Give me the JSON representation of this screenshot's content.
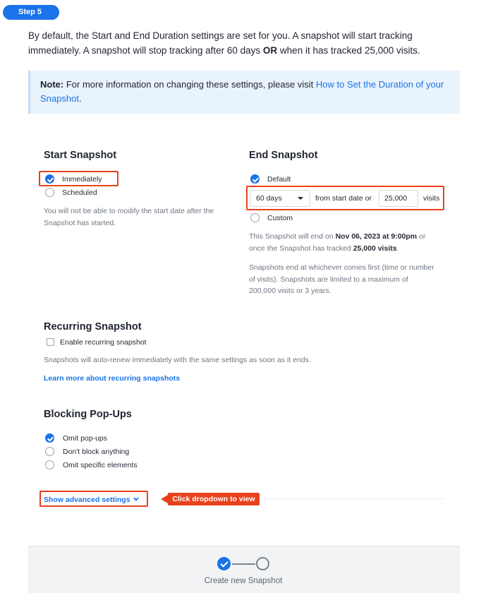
{
  "step_badge": "Step 5",
  "intro": {
    "part1": "By default, the Start and End Duration settings are set for you. A snapshot will start tracking immediately. A snapshot will stop tracking after 60 days ",
    "bold": "OR",
    "part2": " when it has tracked 25,000 visits."
  },
  "note": {
    "label": "Note:",
    "text": " For more information on changing these settings, please visit ",
    "link": "How to Set the Duration of your Snapshot",
    "end": "."
  },
  "start_snapshot": {
    "title": "Start Snapshot",
    "options": [
      {
        "label": "Immediately",
        "selected": true
      },
      {
        "label": "Scheduled",
        "selected": false
      }
    ],
    "help_line1": "You will not be able to modify the start date after the",
    "help_line2": "Snapshot has started."
  },
  "end_snapshot": {
    "title": "End Snapshot",
    "default_label": "Default",
    "duration_select": "60 days",
    "from_text": "from start date or",
    "visits_value": "25,000",
    "visits_label": "visits",
    "custom_label": "Custom",
    "summary": {
      "line1_pre": "This Snapshot will end on ",
      "line1_date": "Nov 06, 2023 at 9:00pm",
      "line1_post": " or",
      "line2_pre": "once the Snapshot has tracked ",
      "line2_visits": "25,000 visits",
      "line2_post": "."
    },
    "limits_line1": "Snapshots end at whichever comes first (time or number",
    "limits_line2": "of visits). Snapshots are limited to a maximum of",
    "limits_line3": "200,000 visits or 3 years."
  },
  "recurring": {
    "title": "Recurring Snapshot",
    "checkbox_label": "Enable recurring snapshot",
    "help": "Snapshots will auto-renew immediately with the same settings as soon as it ends.",
    "link": "Learn more about recurring snapshots"
  },
  "blocking": {
    "title": "Blocking Pop-Ups",
    "options": [
      {
        "label": "Omit pop-ups",
        "selected": true
      },
      {
        "label": "Don't block anything",
        "selected": false
      },
      {
        "label": "Omit specific elements",
        "selected": false
      }
    ]
  },
  "advanced_link": "Show advanced settings",
  "callout": "Click dropdown to view",
  "footer": {
    "label": "Create new Snapshot"
  },
  "colors": {
    "accent": "#1a73e8",
    "highlight": "#e8421d",
    "note_bg": "#e9f3fc"
  }
}
